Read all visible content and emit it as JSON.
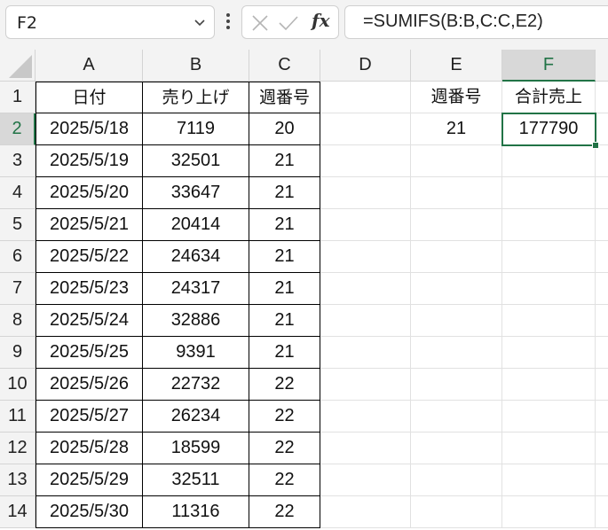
{
  "name_box": {
    "value": "F2"
  },
  "formula_bar": {
    "formula": "=SUMIFS(B:B,C:C,E2)",
    "fx_label": "fx"
  },
  "columns": [
    "A",
    "B",
    "C",
    "D",
    "E",
    "F"
  ],
  "rows": [
    "1",
    "2",
    "3",
    "4",
    "5",
    "6",
    "7",
    "8",
    "9",
    "10",
    "11",
    "12",
    "13",
    "14"
  ],
  "table": {
    "headers": [
      "日付",
      "売り上げ",
      "週番号"
    ],
    "rows": [
      [
        "2025/5/18",
        "7119",
        "20"
      ],
      [
        "2025/5/19",
        "32501",
        "21"
      ],
      [
        "2025/5/20",
        "33647",
        "21"
      ],
      [
        "2025/5/21",
        "20414",
        "21"
      ],
      [
        "2025/5/22",
        "24634",
        "21"
      ],
      [
        "2025/5/23",
        "24317",
        "21"
      ],
      [
        "2025/5/24",
        "32886",
        "21"
      ],
      [
        "2025/5/25",
        "9391",
        "21"
      ],
      [
        "2025/5/26",
        "22732",
        "22"
      ],
      [
        "2025/5/27",
        "26234",
        "22"
      ],
      [
        "2025/5/28",
        "18599",
        "22"
      ],
      [
        "2025/5/29",
        "32511",
        "22"
      ],
      [
        "2025/5/30",
        "11316",
        "22"
      ]
    ]
  },
  "lookup": {
    "e1": "週番号",
    "f1": "合計売上",
    "e2": "21",
    "f2": "177790"
  },
  "colors": {
    "accent": "#217346"
  }
}
